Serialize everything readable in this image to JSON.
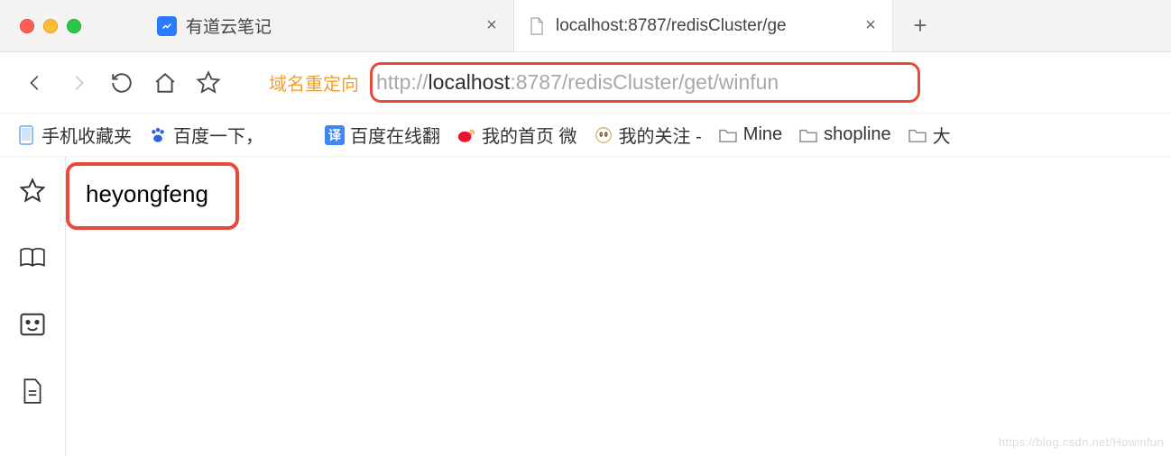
{
  "tabs": [
    {
      "title": "有道云笔记"
    },
    {
      "title": "localhost:8787/redisCluster/ge"
    }
  ],
  "addressbar": {
    "redirect_label": "域名重定向",
    "protocol": "http://",
    "host": "localhost",
    "port": ":8787",
    "path": "/redisCluster/get/winfun"
  },
  "bookmarks": {
    "mobile": "手机收藏夹",
    "baidu": "百度一下，",
    "translate": "百度在线翻",
    "weibo": "我的首页 微",
    "follow": "我的关注 -",
    "mine": "Mine",
    "shopline": "shopline",
    "big": "大"
  },
  "page": {
    "body_text": "heyongfeng"
  },
  "watermark": "https://blog.csdn.net/Howinfun"
}
